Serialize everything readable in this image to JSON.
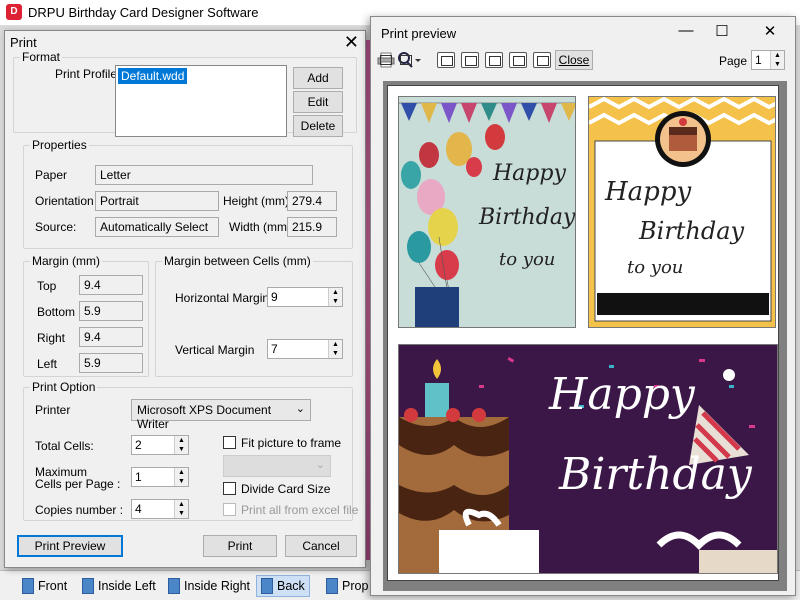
{
  "app": {
    "title": "DRPU Birthday Card Designer Software",
    "logo": "D"
  },
  "print_dialog": {
    "title": "Print",
    "close_glyph": "✕",
    "format_label": "Format",
    "print_profile_label": "Print Profile",
    "profile_selected": "Default.wdd",
    "add_label": "Add",
    "edit_label": "Edit",
    "delete_label": "Delete",
    "properties_label": "Properties",
    "paper_label": "Paper",
    "paper_value": "Letter",
    "orientation_label": "Orientation",
    "orientation_value": "Portrait",
    "height_label": "Height (mm)",
    "height_value": "279.4",
    "source_label": "Source:",
    "source_value": "Automatically Select",
    "width_label": "Width (mm)",
    "width_value": "215.9",
    "margin_label": "Margin (mm)",
    "margin_top_label": "Top",
    "margin_top": "9.4",
    "margin_bottom_label": "Bottom",
    "margin_bottom": "5.9",
    "margin_right_label": "Right",
    "margin_right": "9.4",
    "margin_left_label": "Left",
    "margin_left": "5.9",
    "cells_margin_label": "Margin between Cells (mm)",
    "horizontal_margin_label": "Horizontal Margin",
    "horizontal_margin": "9",
    "vertical_margin_label": "Vertical Margin",
    "vertical_margin": "7",
    "print_option_label": "Print Option",
    "printer_label": "Printer",
    "printer_value": "Microsoft XPS Document Writer",
    "total_cells_label": "Total Cells:",
    "total_cells": "2",
    "max_cells_label_1": "Maximum",
    "max_cells_label_2": "Cells per Page :",
    "max_cells": "1",
    "copies_label": "Copies number :",
    "copies": "4",
    "fit_picture_label": "Fit picture to frame",
    "divide_card_label": "Divide Card Size",
    "print_excel_label": "Print all from excel file",
    "print_preview_label": "Print Preview",
    "print_label": "Print",
    "cancel_label": "Cancel"
  },
  "preview": {
    "title": "Print preview",
    "minimize": "—",
    "maximize": "☐",
    "close": "✕",
    "close_label": "Close",
    "page_label": "Page",
    "page_value": "1"
  },
  "cards": {
    "c1_line1": "Happy",
    "c1_line2": "Birthday",
    "c1_line3": "to you",
    "c2_line1": "Happy",
    "c2_line2": "Birthday",
    "c2_line3": "to you",
    "c3_line1": "Happy",
    "c3_line2": "Birthday"
  },
  "bottom_tabs": [
    "Front",
    "Inside Left",
    "Inside Right",
    "Back",
    "Prop"
  ],
  "colors": {
    "accent": "#0078d7",
    "card3_bg": "#3b1747",
    "card2_border": "#f4c24a"
  }
}
